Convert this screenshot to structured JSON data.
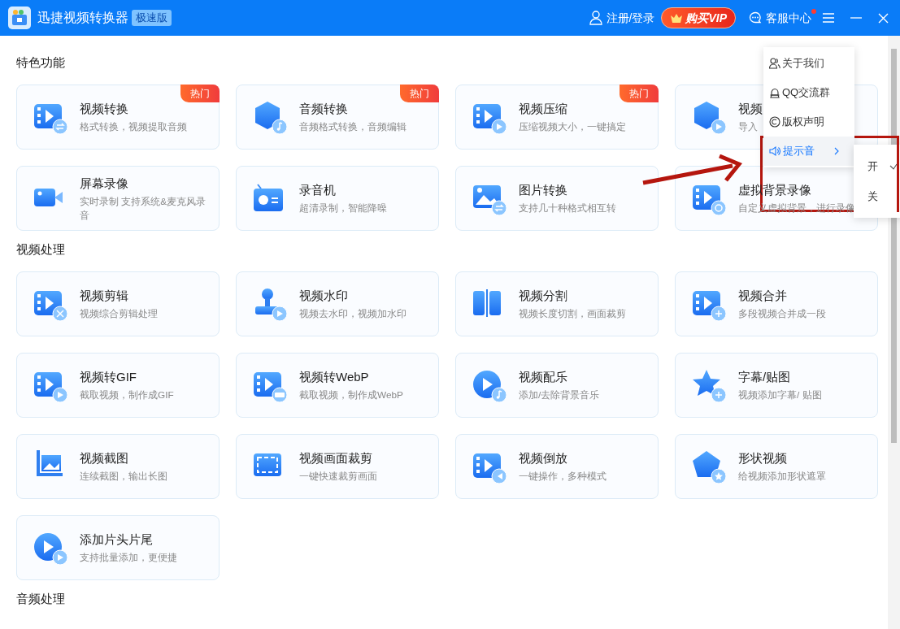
{
  "header": {
    "title": "迅捷视频转换器",
    "edition_badge": "极速版",
    "login": "注册/登录",
    "vip_button": "购买VIP",
    "support": "客服中心",
    "support_unread": true
  },
  "sections": [
    {
      "title": "特色功能",
      "cards": [
        {
          "title": "视频转换",
          "description": "格式转换，视频提取音频",
          "hot": true,
          "hot_badge": "热门"
        },
        {
          "title": "音频转换",
          "description": "音频格式转换，音频编辑",
          "hot": true,
          "hot_badge": "热门"
        },
        {
          "title": "视频压缩",
          "description": "压缩视频大小，一键搞定",
          "hot": true,
          "hot_badge": "热门"
        },
        {
          "title": "视频",
          "description": "导入",
          "hot": false
        },
        {
          "title": "屏幕录像",
          "description": "实时录制 支持系统&麦克风录音",
          "hot": false
        },
        {
          "title": "录音机",
          "description": "超清录制，智能降噪",
          "hot": false
        },
        {
          "title": "图片转换",
          "description": "支持几十种格式相互转",
          "hot": false
        },
        {
          "title": "虚拟背景录像",
          "description": "自定义虚拟背景，进行录像",
          "hot": false
        }
      ]
    },
    {
      "title": "视频处理",
      "cards": [
        {
          "title": "视频剪辑",
          "description": "视频综合剪辑处理",
          "hot": false
        },
        {
          "title": "视频水印",
          "description": "视频去水印，视频加水印",
          "hot": false
        },
        {
          "title": "视频分割",
          "description": "视频长度切割，画面裁剪",
          "hot": false
        },
        {
          "title": "视频合并",
          "description": "多段视频合并成一段",
          "hot": false
        },
        {
          "title": "视频转GIF",
          "description": "截取视频，制作成GIF",
          "hot": false
        },
        {
          "title": "视频转WebP",
          "description": "截取视频，制作成WebP",
          "hot": false
        },
        {
          "title": "视频配乐",
          "description": "添加/去除背景音乐",
          "hot": false
        },
        {
          "title": "字幕/贴图",
          "description": "视频添加字幕/ 贴图",
          "hot": false
        },
        {
          "title": "视频截图",
          "description": "连续截图，输出长图",
          "hot": false
        },
        {
          "title": "视频画面裁剪",
          "description": "一键快速裁剪画面",
          "hot": false
        },
        {
          "title": "视频倒放",
          "description": "一键操作，多种模式",
          "hot": false
        },
        {
          "title": "形状视频",
          "description": "给视频添加形状遮罩",
          "hot": false
        },
        {
          "title": "添加片头片尾",
          "description": "支持批量添加，更便捷",
          "hot": false
        }
      ]
    },
    {
      "title": "音频处理"
    }
  ],
  "menu": {
    "items": [
      {
        "label": "关于我们",
        "kind": "action",
        "selected": false
      },
      {
        "label": "QQ交流群",
        "kind": "action",
        "selected": false
      },
      {
        "label": "版权声明",
        "kind": "action",
        "selected": false
      },
      {
        "label": "提示音",
        "kind": "submenu",
        "selected": true
      }
    ]
  },
  "submenu": {
    "items": [
      {
        "label": "开",
        "checked": true
      },
      {
        "label": "关",
        "checked": false
      }
    ]
  }
}
